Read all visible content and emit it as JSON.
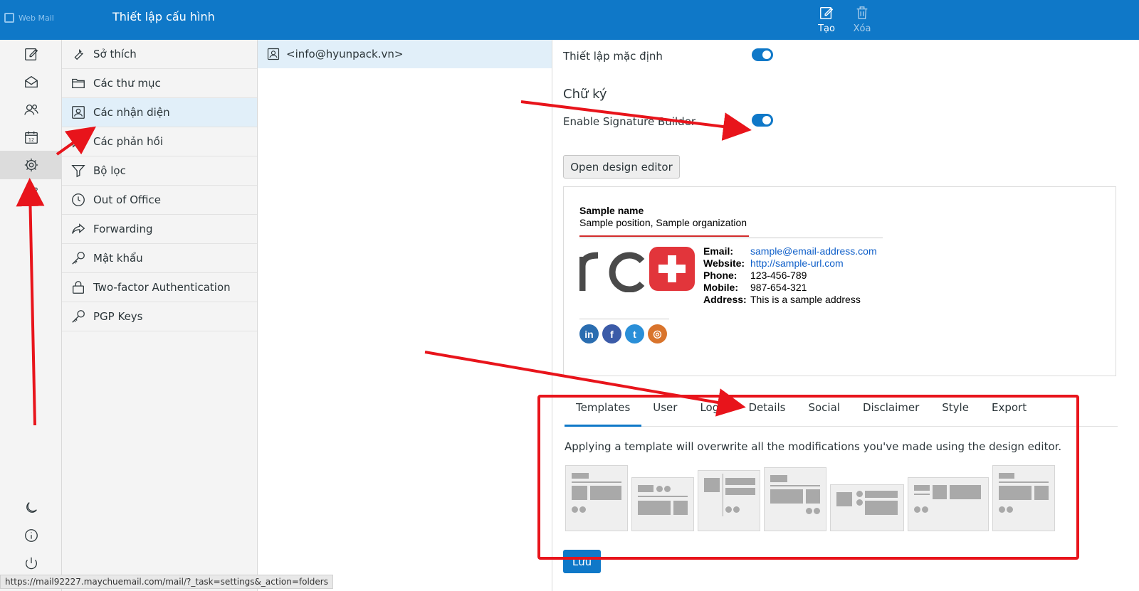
{
  "header": {
    "brand": "Web Mail",
    "title": "Thiết lập cấu hình",
    "create_label": "Tạo",
    "delete_label": "Xóa"
  },
  "settings_menu": {
    "items": [
      {
        "label": "Sở thích",
        "icon": "wrench-icon"
      },
      {
        "label": "Các thư mục",
        "icon": "folder-icon"
      },
      {
        "label": "Các nhận diện",
        "icon": "identity-card-icon",
        "active": true
      },
      {
        "label": "Các phản hồi",
        "icon": "reply-icon"
      },
      {
        "label": "Bộ lọc",
        "icon": "filter-icon"
      },
      {
        "label": "Out of Office",
        "icon": "clock-icon"
      },
      {
        "label": "Forwarding",
        "icon": "forward-icon"
      },
      {
        "label": "Mật khẩu",
        "icon": "key-icon"
      },
      {
        "label": "Two-factor Authentication",
        "icon": "lock-icon"
      },
      {
        "label": "PGP Keys",
        "icon": "key-icon"
      }
    ]
  },
  "identities": {
    "items": [
      {
        "label": "<info@hyunpack.vn>"
      }
    ]
  },
  "identity_form": {
    "default_label": "Thiết lập mặc định",
    "default_on": true,
    "signature_heading": "Chữ ký",
    "enable_builder_label": "Enable Signature Builder",
    "enable_builder_on": true,
    "open_editor_label": "Open design editor",
    "save_label": "Lưu"
  },
  "signature_preview": {
    "name": "Sample name",
    "position": "Sample position, Sample organization",
    "details": [
      {
        "key": "Email:",
        "value": "sample@email-address.com",
        "link": true
      },
      {
        "key": "Website:",
        "value": "http://sample-url.com",
        "link": true
      },
      {
        "key": "Phone:",
        "value": "123-456-789",
        "link": false
      },
      {
        "key": "Mobile:",
        "value": "987-654-321",
        "link": false
      },
      {
        "key": "Address:",
        "value": "This is a sample address",
        "link": false
      }
    ],
    "socials": [
      {
        "name": "linkedin-icon",
        "glyph": "in",
        "color": "#2a6db0"
      },
      {
        "name": "facebook-icon",
        "glyph": "f",
        "color": "#3b5ba8"
      },
      {
        "name": "twitter-icon",
        "glyph": "t",
        "color": "#2a8fd8"
      },
      {
        "name": "instagram-icon",
        "glyph": "◎",
        "color": "#d9742c"
      }
    ]
  },
  "editor_tabs": {
    "items": [
      "Templates",
      "User",
      "Logo",
      "Details",
      "Social",
      "Disclaimer",
      "Style",
      "Export"
    ],
    "active": "Templates"
  },
  "templates": {
    "hint": "Applying a template will overwrite all the modifications you've made using the design editor."
  },
  "status_bar": {
    "url": "https://mail92227.maychuemail.com/mail/?_task=settings&_action=folders"
  },
  "colors": {
    "header": "#0f78c8",
    "accent": "#0f78c8",
    "annotation": "#e8141b"
  }
}
